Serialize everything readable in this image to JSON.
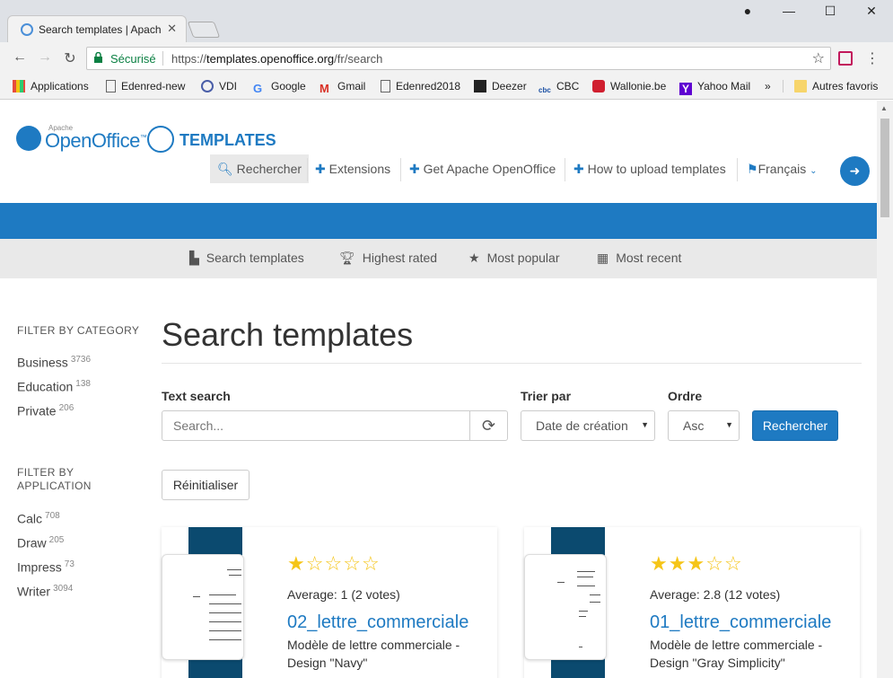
{
  "browser": {
    "tab_title": "Search templates | Apach",
    "secure_label": "Sécurisé",
    "url_prefix": "https://",
    "url_host": "templates.openoffice.org",
    "url_path": "/fr/search",
    "bookmarks": [
      {
        "label": "Applications",
        "icon": "apps-grid-icon"
      },
      {
        "label": "Edenred-new",
        "icon": "page-icon"
      },
      {
        "label": "VDI",
        "icon": "vdi-icon"
      },
      {
        "label": "Google",
        "icon": "google-icon"
      },
      {
        "label": "Gmail",
        "icon": "gmail-icon"
      },
      {
        "label": "Edenred2018",
        "icon": "page-icon"
      },
      {
        "label": "Deezer",
        "icon": "deezer-icon"
      },
      {
        "label": "CBC",
        "icon": "cbc-icon"
      },
      {
        "label": "Wallonie.be",
        "icon": "wallonie-icon"
      },
      {
        "label": "Yahoo Mail",
        "icon": "yahoo-icon"
      },
      {
        "label": "»",
        "icon": ""
      },
      {
        "label": "Autres favoris",
        "icon": "folder-icon"
      }
    ]
  },
  "site": {
    "logo_apache": "Apache",
    "logo_name": "OpenOffice",
    "logo_tm": "™",
    "templates_logo": "TEMPLATES",
    "nav": [
      {
        "label": "Rechercher",
        "icon": "search-icon"
      },
      {
        "label": "Extensions",
        "icon": "puzzle-icon"
      },
      {
        "label": "Get Apache OpenOffice",
        "icon": "puzzle-icon"
      },
      {
        "label": "How to upload templates",
        "icon": "puzzle-icon"
      },
      {
        "label": "Français",
        "icon": "flag-icon"
      }
    ],
    "subnav": [
      {
        "label": "Search templates",
        "icon": "file-icon"
      },
      {
        "label": "Highest rated",
        "icon": "trophy-icon"
      },
      {
        "label": "Most popular",
        "icon": "star-icon"
      },
      {
        "label": "Most recent",
        "icon": "calendar-icon"
      }
    ]
  },
  "sidebar": {
    "category_heading_1": "FILTER BY CATEGORY",
    "categories": [
      {
        "label": "Business",
        "count": "3736"
      },
      {
        "label": "Education",
        "count": "138"
      },
      {
        "label": "Private",
        "count": "206"
      }
    ],
    "application_heading_1": "FILTER BY",
    "application_heading_2": "APPLICATION",
    "applications": [
      {
        "label": "Calc",
        "count": "708"
      },
      {
        "label": "Draw",
        "count": "205"
      },
      {
        "label": "Impress",
        "count": "73"
      },
      {
        "label": "Writer",
        "count": "3094"
      }
    ]
  },
  "main": {
    "title": "Search templates",
    "text_search_label": "Text search",
    "search_placeholder": "Search...",
    "sort_label": "Trier par",
    "sort_value": "Date de création",
    "order_label": "Ordre",
    "order_value": "Asc",
    "search_button": "Rechercher",
    "reset_button": "Réinitialiser"
  },
  "results": [
    {
      "rating": 1,
      "avg": "Average: 1 (2 votes)",
      "name": "02_lettre_commerciale",
      "desc": "Modèle de lettre commerciale - Design \"Navy\""
    },
    {
      "rating": 3,
      "avg": "Average: 2.8 (12 votes)",
      "name": "01_lettre_commerciale",
      "desc": "Modèle de lettre commerciale - Design \"Gray Simplicity\""
    }
  ],
  "colors": {
    "accent": "#1e7ac2",
    "band": "#0b4a6f",
    "star": "#f5c518"
  }
}
